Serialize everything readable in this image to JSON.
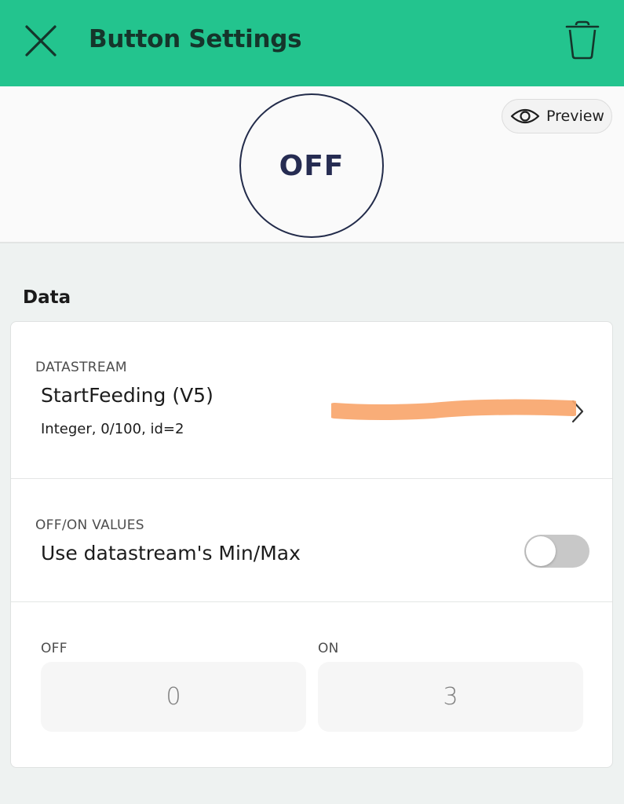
{
  "header": {
    "title": "Button Settings",
    "close_icon": "close-icon",
    "trash_icon": "trash-icon",
    "background_color": "#23c48e"
  },
  "preview": {
    "button_state": "OFF",
    "preview_label": "Preview",
    "preview_icon": "eye-icon"
  },
  "section": {
    "title": "Data"
  },
  "datastream": {
    "caption": "DATASTREAM",
    "name": "StartFeeding (V5)",
    "details": "Integer, 0/100, id=2",
    "chevron_icon": "chevron-right-icon"
  },
  "values": {
    "caption": "OFF/ON VALUES",
    "label": "Use datastream's Min/Max",
    "toggle_on": false
  },
  "inputs": {
    "off_caption": "OFF",
    "off_value": "0",
    "on_caption": "ON",
    "on_value": "3",
    "highlight_color": "#f9a66c"
  }
}
